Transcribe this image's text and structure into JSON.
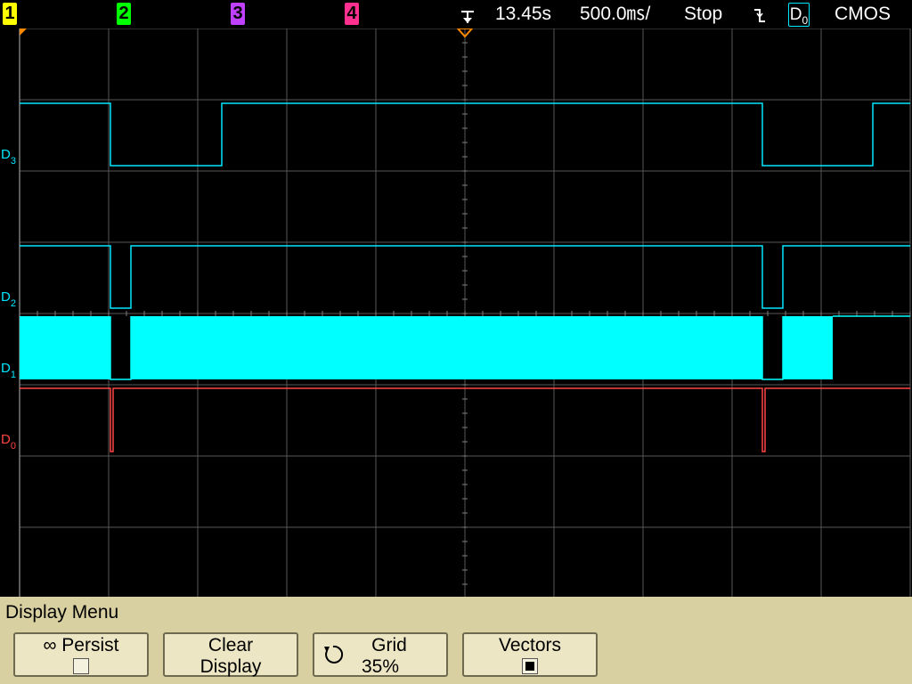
{
  "status_bar": {
    "channels": [
      {
        "label": "1",
        "color": "#ffff00"
      },
      {
        "label": "2",
        "color": "#00ff00"
      },
      {
        "label": "3",
        "color": "#c040ff"
      },
      {
        "label": "4",
        "color": "#ff3090"
      }
    ],
    "time_position": "13.45s",
    "time_per_div": "500.0㎳/",
    "run_state": "Stop",
    "trigger_source": "D",
    "trigger_source_sub": "0",
    "logic_threshold": "CMOS"
  },
  "waveform": {
    "channel_labels": [
      {
        "main": "D",
        "sub": "3",
        "color": "#00e8ff"
      },
      {
        "main": "D",
        "sub": "2",
        "color": "#00e8ff"
      },
      {
        "main": "D",
        "sub": "1",
        "color": "#00e8ff"
      },
      {
        "main": "D",
        "sub": "0",
        "color": "#ff4444"
      }
    ]
  },
  "menu": {
    "title": "Display Menu",
    "softkeys": [
      {
        "line1": "∞ Persist",
        "checkbox": false
      },
      {
        "line1": "Clear",
        "line2": "Display"
      },
      {
        "line1": "Grid",
        "line2": "35%"
      },
      {
        "line1": "Vectors",
        "checkbox": true
      }
    ]
  }
}
